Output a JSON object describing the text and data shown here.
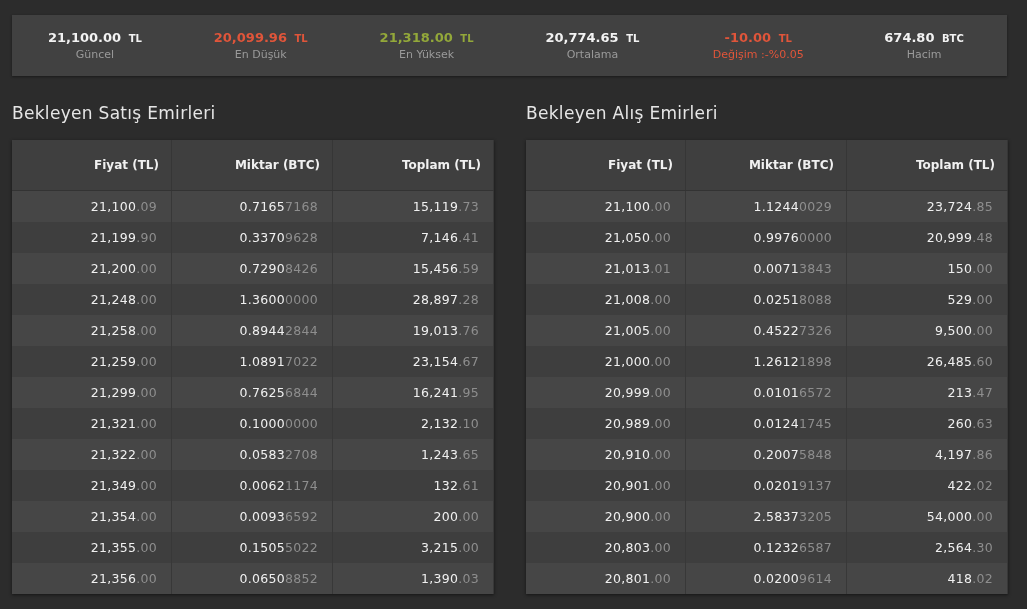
{
  "stats": [
    {
      "kind": "figure",
      "value": "21,100.00",
      "unit": "TL",
      "label": "Güncel",
      "color": "#f2f2f2"
    },
    {
      "kind": "figure",
      "value": "20,099.96",
      "unit": "TL",
      "label": "En Düşük",
      "color": "#e0553a"
    },
    {
      "kind": "figure",
      "value": "21,318.00",
      "unit": "TL",
      "label": "En Yüksek",
      "color": "#93a83a"
    },
    {
      "kind": "figure",
      "value": "20,774.65",
      "unit": "TL",
      "label": "Ortalama",
      "color": "#f2f2f2"
    },
    {
      "kind": "change",
      "value": "-10.00",
      "unit": "TL",
      "label": "Değişim :-%0.05",
      "color": "#e0553a"
    },
    {
      "kind": "figure",
      "value": "674.80",
      "unit": "BTC",
      "label": "Hacim",
      "color": "#f2f2f2"
    }
  ],
  "order_books": [
    {
      "title": "Bekleyen Satış Emirleri",
      "columns": [
        "Fiyat (TL)",
        "Miktar (BTC)",
        "Toplam (TL)"
      ],
      "rows": [
        [
          "21,100.09",
          "0.71657168",
          "15,119.73"
        ],
        [
          "21,199.90",
          "0.33709628",
          "7,146.41"
        ],
        [
          "21,200.00",
          "0.72908426",
          "15,456.59"
        ],
        [
          "21,248.00",
          "1.36000000",
          "28,897.28"
        ],
        [
          "21,258.00",
          "0.89442844",
          "19,013.76"
        ],
        [
          "21,259.00",
          "1.08917022",
          "23,154.67"
        ],
        [
          "21,299.00",
          "0.76256844",
          "16,241.95"
        ],
        [
          "21,321.00",
          "0.10000000",
          "2,132.10"
        ],
        [
          "21,322.00",
          "0.05832708",
          "1,243.65"
        ],
        [
          "21,349.00",
          "0.00621174",
          "132.61"
        ],
        [
          "21,354.00",
          "0.00936592",
          "200.00"
        ],
        [
          "21,355.00",
          "0.15055022",
          "3,215.00"
        ],
        [
          "21,356.00",
          "0.06508852",
          "1,390.03"
        ]
      ]
    },
    {
      "title": "Bekleyen Alış Emirleri",
      "columns": [
        "Fiyat (TL)",
        "Miktar (BTC)",
        "Toplam (TL)"
      ],
      "rows": [
        [
          "21,100.00",
          "1.12440029",
          "23,724.85"
        ],
        [
          "21,050.00",
          "0.99760000",
          "20,999.48"
        ],
        [
          "21,013.01",
          "0.00713843",
          "150.00"
        ],
        [
          "21,008.00",
          "0.02518088",
          "529.00"
        ],
        [
          "21,005.00",
          "0.45227326",
          "9,500.00"
        ],
        [
          "21,000.00",
          "1.26121898",
          "26,485.60"
        ],
        [
          "20,999.00",
          "0.01016572",
          "213.47"
        ],
        [
          "20,989.00",
          "0.01241745",
          "260.63"
        ],
        [
          "20,910.00",
          "0.20075848",
          "4,197.86"
        ],
        [
          "20,901.00",
          "0.02019137",
          "422.02"
        ],
        [
          "20,900.00",
          "2.58373205",
          "54,000.00"
        ],
        [
          "20,803.00",
          "0.12326587",
          "2,564.30"
        ],
        [
          "20,801.00",
          "0.02009614",
          "418.02"
        ]
      ]
    }
  ]
}
